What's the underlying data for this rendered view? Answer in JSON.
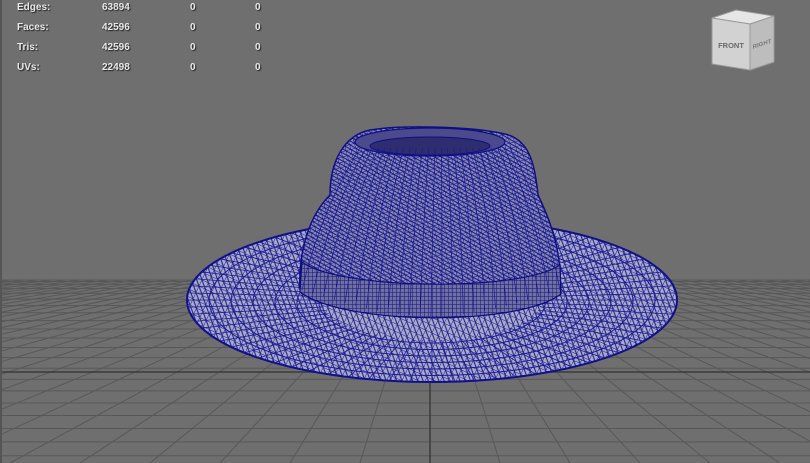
{
  "hud": {
    "rows": [
      {
        "label": "Edges:",
        "v1": "63894",
        "v2": "0",
        "v3": "0"
      },
      {
        "label": "Faces:",
        "v1": "42596",
        "v2": "0",
        "v3": "0"
      },
      {
        "label": "Tris:",
        "v1": "42596",
        "v2": "0",
        "v3": "0"
      },
      {
        "label": "UVs:",
        "v1": "22498",
        "v2": "0",
        "v3": "0"
      }
    ]
  },
  "view_cube": {
    "front_label": "FRONT",
    "right_label": "RIGHT"
  },
  "colors": {
    "background": "#6f6f6f",
    "grid": "#5a5a5a",
    "grid_axis": "#3a3a3a",
    "wireframe": "#1a1a9a",
    "wire_fill": "#b9b9c8"
  },
  "scene": {
    "object_icon": "hat-wireframe-icon",
    "grid_icon": "grid-plane-icon"
  }
}
